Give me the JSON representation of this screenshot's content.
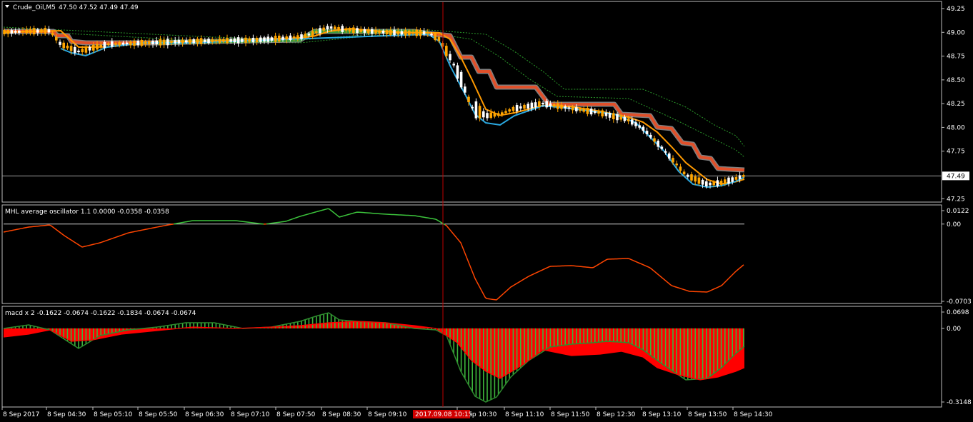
{
  "window": {
    "title": "Crude_Oil,M5",
    "ohlc": "47.50 47.52 47.49 47.49"
  },
  "main_pane": {
    "price_ticks": [
      "49.25",
      "49.00",
      "48.75",
      "48.50",
      "48.25",
      "48.00",
      "47.75",
      "47.25"
    ],
    "price_values": [
      49.25,
      49.0,
      48.75,
      48.5,
      48.25,
      48.0,
      47.75,
      47.25
    ],
    "current_price": "47.49",
    "current_value": 47.49
  },
  "osc_pane": {
    "title": "MHL average oscillator 1.1 0.0000 -0.0358 -0.0358",
    "ticks": [
      "0.0122",
      "0.00",
      "-0.0703"
    ],
    "tick_values": [
      0.0122,
      0.0,
      -0.0703
    ]
  },
  "macd_pane": {
    "title": "macd x 2 -0.1622 -0.0674 -0.1622 -0.1834 -0.0674 -0.0674",
    "ticks": [
      "0.0698",
      "0.00",
      "-0.3148"
    ],
    "tick_values": [
      0.0698,
      0.0,
      -0.3148
    ]
  },
  "time_axis": {
    "labels": [
      "8 Sep 2017",
      "8 Sep 04:30",
      "8 Sep 05:10",
      "8 Sep 05:50",
      "8 Sep 06:30",
      "8 Sep 07:10",
      "8 Sep 07:50",
      "8 Sep 08:30",
      "8 Sep 09:10",
      "8 Sep 10:30",
      "8 Sep 11:10",
      "8 Sep 11:50",
      "8 Sep 12:30",
      "8 Sep 13:10",
      "8 Sep 13:50",
      "8 Sep 14:30"
    ],
    "cursor_label": "2017.09.08 10:15"
  },
  "colors": {
    "background": "#000000",
    "axis_text": "#ffffff",
    "bull_candle": "#ffffff",
    "bear_candle": "#ffa500",
    "band_orange_red": "#e0502a",
    "band_green": "#3c9a3c",
    "band_gray": "#808080",
    "ma_blue": "#2aa8e0",
    "ma_orange": "#ff9a00",
    "dotted_green": "#2a9a2a",
    "osc_green": "#3cc43c",
    "osc_red": "#ff4500",
    "macd_red": "#ff0000",
    "macd_green": "#3cb43c",
    "cursor_line": "#c00000"
  },
  "icons": [
    "dropdown-triangle-icon"
  ]
}
